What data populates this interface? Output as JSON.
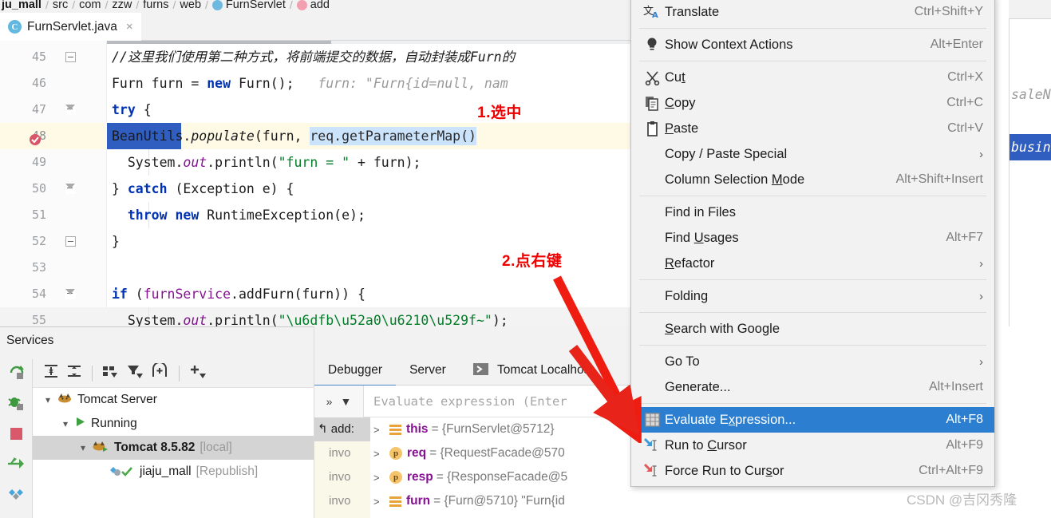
{
  "breadcrumb": {
    "segments": [
      "ju_mall",
      "src",
      "com",
      "zzw",
      "furns",
      "web",
      "FurnServlet",
      "add"
    ]
  },
  "tab": {
    "label": "FurnServlet.java",
    "icon": "C",
    "close": "×"
  },
  "editor": {
    "lines": [
      {
        "num": "45",
        "kind": "comment",
        "text": "//这里我们使用第二种方式，将前端提交的数据，自动封装成Furn的"
      },
      {
        "num": "46",
        "kind": "code",
        "text": "Furn furn = new Furn();   furn: \"Furn{id=null, nam"
      },
      {
        "num": "47",
        "kind": "code",
        "text": "try {"
      },
      {
        "num": "48",
        "kind": "code",
        "text": "BeanUtils.populate(furn, req.getParameterMap()"
      },
      {
        "num": "49",
        "kind": "code",
        "text": "System.out.println(\"furn = \" + furn);"
      },
      {
        "num": "50",
        "kind": "code",
        "text": "} catch (Exception e) {"
      },
      {
        "num": "51",
        "kind": "code",
        "text": "throw new RuntimeException(e);"
      },
      {
        "num": "52",
        "kind": "code",
        "text": "}"
      },
      {
        "num": "53",
        "kind": "code",
        "text": ""
      },
      {
        "num": "54",
        "kind": "code",
        "text": "if (furnService.addFurn(furn)) {"
      },
      {
        "num": "55",
        "kind": "code",
        "text": "System.out.println(\"添加成功~\");"
      }
    ],
    "right_sliver": [
      "saleNu",
      "busine"
    ]
  },
  "annotations": [
    {
      "id": "step1",
      "text": "1.选中"
    },
    {
      "id": "step2",
      "text": "2.点右键"
    }
  ],
  "context_menu": {
    "items": [
      {
        "label": "Translate",
        "shortcut": "Ctrl+Shift+Y",
        "icon": "translate-icon",
        "selected": false
      },
      {
        "sep": true
      },
      {
        "label": "Show Context Actions",
        "shortcut": "Alt+Enter",
        "icon": "lightbulb-icon",
        "selected": false
      },
      {
        "sep": true
      },
      {
        "label": "Cut",
        "shortcut": "Ctrl+X",
        "icon": "scissors-icon",
        "mnemonic": "t",
        "selected": false
      },
      {
        "label": "Copy",
        "shortcut": "Ctrl+C",
        "icon": "copy-icon",
        "mnemonic": "C",
        "selected": false
      },
      {
        "label": "Paste",
        "shortcut": "Ctrl+V",
        "icon": "clipboard-icon",
        "mnemonic": "P",
        "selected": false
      },
      {
        "label": "Copy / Paste Special",
        "shortcut": "",
        "arrow": true,
        "selected": false
      },
      {
        "label": "Column Selection Mode",
        "shortcut": "Alt+Shift+Insert",
        "mnemonic": "M",
        "selected": false
      },
      {
        "sep": true
      },
      {
        "label": "Find in Files",
        "shortcut": "",
        "selected": false
      },
      {
        "label": "Find Usages",
        "shortcut": "Alt+F7",
        "mnemonic": "U",
        "selected": false
      },
      {
        "label": "Refactor",
        "shortcut": "",
        "arrow": true,
        "mnemonic": "R",
        "selected": false
      },
      {
        "sep": true
      },
      {
        "label": "Folding",
        "shortcut": "",
        "arrow": true,
        "selected": false
      },
      {
        "sep": true
      },
      {
        "label": "Search with Google",
        "shortcut": "",
        "mnemonic": "S",
        "selected": false
      },
      {
        "sep": true
      },
      {
        "label": "Go To",
        "shortcut": "",
        "arrow": true,
        "selected": false
      },
      {
        "label": "Generate...",
        "shortcut": "Alt+Insert",
        "selected": false
      },
      {
        "sep": true
      },
      {
        "label": "Evaluate Expression...",
        "shortcut": "Alt+F8",
        "icon": "evaluate-icon",
        "mnemonic": "x",
        "selected": true
      },
      {
        "label": "Run to Cursor",
        "shortcut": "Alt+F9",
        "icon": "run-to-cursor-icon",
        "mnemonic": "C",
        "selected": false
      },
      {
        "label": "Force Run to Cursor",
        "shortcut": "Ctrl+Alt+F9",
        "icon": "force-run-to-cursor-icon",
        "mnemonic": "s",
        "selected": false
      }
    ]
  },
  "services": {
    "title": "Services",
    "tree": [
      {
        "label": "Tomcat Server",
        "depth": 0,
        "icon": "tomcat-icon",
        "expanded": true,
        "selected": false
      },
      {
        "label": "Running",
        "depth": 1,
        "icon": "run-icon",
        "expanded": true,
        "selected": false
      },
      {
        "label": "Tomcat 8.5.82",
        "suffix": "[local]",
        "depth": 2,
        "icon": "tomcat-run-icon",
        "expanded": true,
        "selected": true,
        "bold": true
      },
      {
        "label": "jiaju_mall",
        "suffix": "[Republish]",
        "depth": 3,
        "icon": "artifact-icon",
        "selected": false
      }
    ],
    "toolbar_icons": [
      "expand-all-icon",
      "collapse-all-icon",
      "group-by-icon",
      "filter-icon",
      "new-tab-icon",
      "add-icon"
    ],
    "side_icons": [
      "rerun-icon",
      "rerun-debug-icon",
      "stop-icon",
      "deploy-icon",
      "artifacts-icon"
    ]
  },
  "debugger": {
    "tabs": [
      {
        "label": "Debugger",
        "active": true
      },
      {
        "label": "Server",
        "active": false
      },
      {
        "label": "Tomcat Localhost",
        "active": false,
        "icon": "console-icon"
      }
    ],
    "evaluate_placeholder": "Evaluate expression (Enter",
    "frames": [
      "add:",
      "invo",
      "invo",
      "invo"
    ],
    "variables": [
      {
        "chevron": ">",
        "icon": "field-icon",
        "name": "this",
        "value": "= {FurnServlet@5712}"
      },
      {
        "chevron": ">",
        "icon": "param-icon",
        "name": "req",
        "value": "= {RequestFacade@570"
      },
      {
        "chevron": ">",
        "icon": "param-icon",
        "name": "resp",
        "value": "= {ResponseFacade@5"
      },
      {
        "chevron": ">",
        "icon": "field-icon",
        "name": "furn",
        "value": "= {Furn@5710} \"Furn{id"
      }
    ],
    "right_toolbar_icons": [
      "step-out-icon",
      "run-to-cursor-icon"
    ]
  },
  "watermark": "CSDN @吉冈秀隆",
  "colors": {
    "accent_blue": "#2c7fd0",
    "selection_blue": "#2f5dc0",
    "annotation_red": "#ee0000",
    "keyword_blue": "#0033b3",
    "string_green": "#027d27",
    "field_purple": "#871094"
  }
}
